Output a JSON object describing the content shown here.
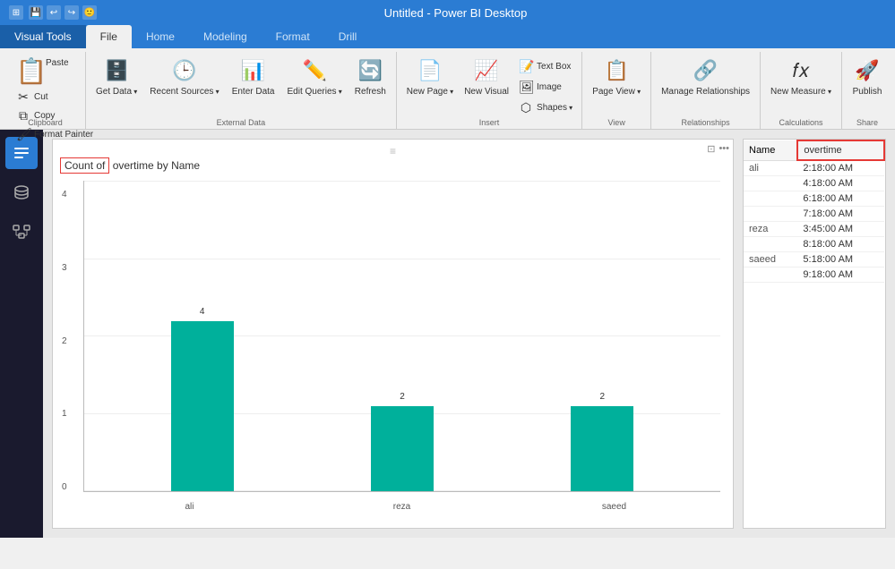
{
  "titleBar": {
    "appTitle": "Untitled - Power BI Desktop",
    "icons": [
      "💾",
      "↩",
      "↪",
      "🙂"
    ]
  },
  "tabs": {
    "visualTools": "Visual Tools",
    "file": "File",
    "home": "Home",
    "modeling": "Modeling",
    "format": "Format",
    "drill": "Drill"
  },
  "ribbon": {
    "clipboard": {
      "label": "Clipboard",
      "paste": "Paste",
      "cut": "Cut",
      "copy": "Copy",
      "formatPainter": "Format Painter"
    },
    "externalData": {
      "label": "External Data",
      "getData": "Get Data",
      "recentSources": "Recent Sources",
      "enterData": "Enter Data",
      "editQueries": "Edit Queries",
      "refresh": "Refresh"
    },
    "insert": {
      "label": "Insert",
      "newPage": "New Page",
      "newVisual": "New Visual",
      "textBox": "Text Box",
      "image": "Image",
      "shapes": "Shapes"
    },
    "view": {
      "label": "View",
      "pageView": "Page View"
    },
    "relationships": {
      "label": "Relationships",
      "manageRelationships": "Manage Relationships"
    },
    "calculations": {
      "label": "Calculations",
      "newMeasure": "New Measure"
    },
    "share": {
      "label": "Share",
      "publish": "Publish"
    }
  },
  "sidebar": {
    "icons": [
      "report",
      "data",
      "model"
    ]
  },
  "chart": {
    "title": "Count of overtime by Name",
    "titleHighlighted": "Count of",
    "bars": [
      {
        "name": "ali",
        "value": 4,
        "heightPct": 100
      },
      {
        "name": "reza",
        "value": 2,
        "heightPct": 50
      },
      {
        "name": "saeed",
        "value": 2,
        "heightPct": 50
      }
    ],
    "yAxisLabels": [
      "0",
      "1",
      "2",
      "3",
      "4"
    ],
    "color": "#00b09b"
  },
  "table": {
    "columns": {
      "name": "Name",
      "overtime": "overtime"
    },
    "rows": [
      {
        "name": "ali",
        "overtime": "2:18:00 AM"
      },
      {
        "name": "",
        "overtime": "4:18:00 AM"
      },
      {
        "name": "",
        "overtime": "6:18:00 AM"
      },
      {
        "name": "",
        "overtime": "7:18:00 AM"
      },
      {
        "name": "reza",
        "overtime": "3:45:00 AM"
      },
      {
        "name": "",
        "overtime": "8:18:00 AM"
      },
      {
        "name": "saeed",
        "overtime": "5:18:00 AM"
      },
      {
        "name": "",
        "overtime": "9:18:00 AM"
      }
    ]
  }
}
